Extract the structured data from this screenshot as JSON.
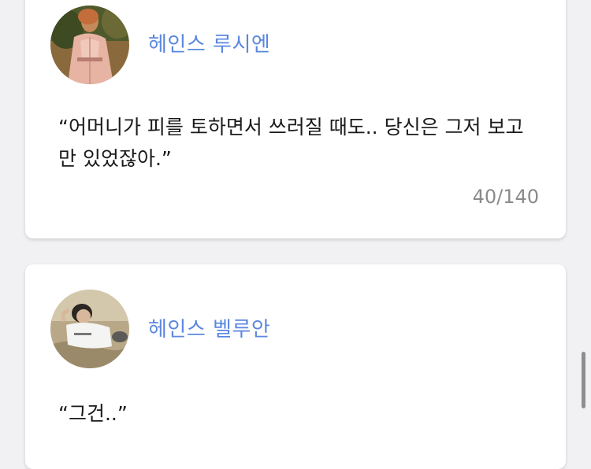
{
  "posts": [
    {
      "author": "헤인스 루시엔",
      "text": "“어머니가 피를 토하면서 쓰러질 때도.. 당신은 그저 보고만 있었잖아.”",
      "char_count": "40/140",
      "avatar_icon": "woman-in-pink-dress-avatar"
    },
    {
      "author": "헤인스 벨루안",
      "text": "“그건..”",
      "avatar_icon": "man-lying-on-grass-avatar"
    }
  ],
  "colors": {
    "author_name": "#5b87e0",
    "background": "#f1f1f3",
    "card": "#ffffff"
  }
}
